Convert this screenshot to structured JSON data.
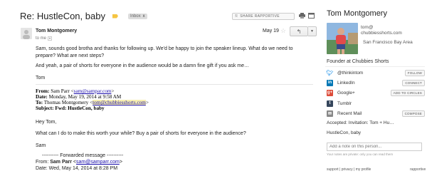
{
  "email": {
    "subject": "Re: HustleCon, baby",
    "label": "Inbox",
    "label_close": "x",
    "rapportive_toggle": "SHARE RAPPORTIVE",
    "sender": "Tom Montgomery",
    "recipient": "to me",
    "date": "May 19",
    "reply": {
      "paragraphs": [
        "Sam, sounds good brotha and thanks for following up. We'd be happy to join the speaker lineup. What do we need to prepare? What are next steps?",
        "And yeah, a pair of shorts for everyone in the audience would be a damn fine gift if you ask me…",
        "Tom"
      ]
    },
    "forwarded_header": {
      "from_label": "From:",
      "from_name": "Sam Parr",
      "from_email": "sam@sampar.com",
      "date_label": "Date:",
      "date_value": "Monday, May 19, 2014 at 9:58 AM",
      "to_label": "To:",
      "to_name": "Thomas Montgomery",
      "to_email": "tom@chubbiesshorts.com",
      "subject_label": "Subject:",
      "subject_value": "Fwd: HustleCon, baby"
    },
    "quoted": {
      "greeting": "Hey Tom,",
      "question": "What can I do to make this worth your while? Buy a pair of shorts for everyone in the audience?",
      "signoff": "Sam",
      "fwd_marker": "---------- Forwarded message ----------",
      "fwd_from_label": "From:",
      "fwd_from_name": "Sam Parr",
      "fwd_from_email": "sam@samparr.com",
      "fwd_date": "Date: Wed, May 14, 2014 at 8:28 PM"
    }
  },
  "sidebar": {
    "name": "Tom Montgomery",
    "email_1": "tom@",
    "email_2": "chubbiesshorts.com",
    "location": "San Francisco Bay Area",
    "title": "Founder at Chubbies Shorts",
    "twitter": {
      "label": "@thinkintom",
      "action": "FOLLOW",
      "color": "#55acee"
    },
    "linkedin": {
      "label": "LinkedIn",
      "action": "CONNECT",
      "color": "#0077b5"
    },
    "googleplus": {
      "label": "Google+",
      "action": "ADD TO CIRCLES",
      "color": "#dd4b39"
    },
    "tumblr": {
      "label": "Tumblr",
      "color": "#35465c"
    },
    "recent_mail": {
      "label": "Recent Mail",
      "action": "COMPOSE"
    },
    "mail_1": "Accepted: Invitation: Tom + Hu…",
    "mail_2": "HustleCon, baby",
    "note_placeholder": "Add a note on this person...",
    "note_help": "Your notes are private: only you can read them",
    "footer": "support | privacy | my profile",
    "brand": "rapportive"
  }
}
